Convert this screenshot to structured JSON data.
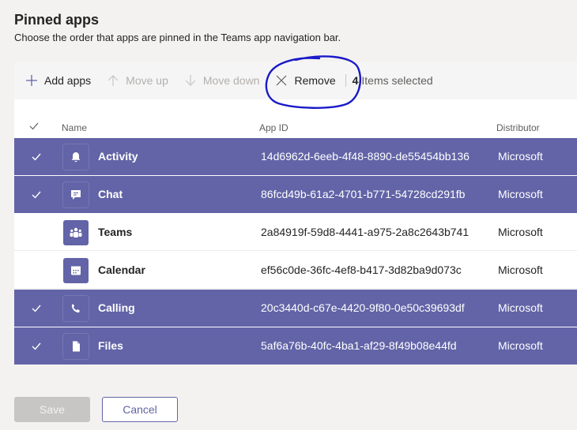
{
  "header": {
    "title": "Pinned apps",
    "subtitle": "Choose the order that apps are pinned in the Teams app navigation bar."
  },
  "toolbar": {
    "add_label": "Add apps",
    "move_up_label": "Move up",
    "move_down_label": "Move down",
    "remove_label": "Remove",
    "selected_count": "4",
    "selected_suffix": "Items selected"
  },
  "table": {
    "columns": {
      "name": "Name",
      "app_id": "App ID",
      "distributor": "Distributor"
    },
    "rows": [
      {
        "name": "Activity",
        "app_id": "14d6962d-6eeb-4f48-8890-de55454bb136",
        "distributor": "Microsoft",
        "selected": true,
        "icon": "bell-icon"
      },
      {
        "name": "Chat",
        "app_id": "86fcd49b-61a2-4701-b771-54728cd291fb",
        "distributor": "Microsoft",
        "selected": true,
        "icon": "chat-icon"
      },
      {
        "name": "Teams",
        "app_id": "2a84919f-59d8-4441-a975-2a8c2643b741",
        "distributor": "Microsoft",
        "selected": false,
        "icon": "teams-icon"
      },
      {
        "name": "Calendar",
        "app_id": "ef56c0de-36fc-4ef8-b417-3d82ba9d073c",
        "distributor": "Microsoft",
        "selected": false,
        "icon": "calendar-icon"
      },
      {
        "name": "Calling",
        "app_id": "20c3440d-c67e-4420-9f80-0e50c39693df",
        "distributor": "Microsoft",
        "selected": true,
        "icon": "phone-icon"
      },
      {
        "name": "Files",
        "app_id": "5af6a76b-40fc-4ba1-af29-8f49b08e44fd",
        "distributor": "Microsoft",
        "selected": true,
        "icon": "file-icon"
      }
    ]
  },
  "footer": {
    "save_label": "Save",
    "cancel_label": "Cancel"
  },
  "colors": {
    "accent": "#6264a7",
    "annotation": "#1a1ac8",
    "background": "#f3f2f1"
  }
}
